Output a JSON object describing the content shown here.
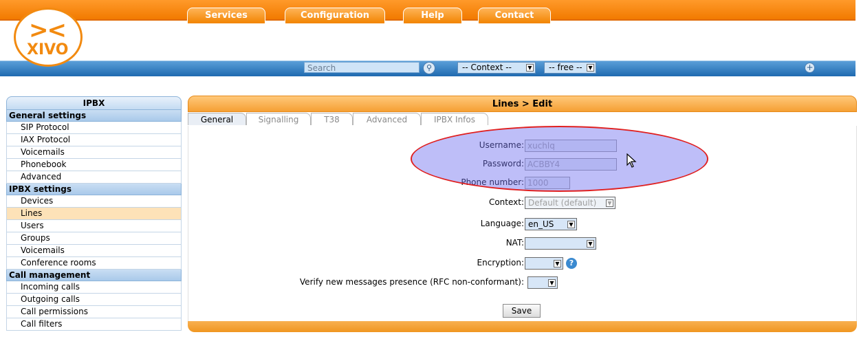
{
  "header": {
    "nav_tabs": [
      "Services",
      "Configuration",
      "Help",
      "Contact"
    ],
    "logo_text": "XIVO",
    "search": {
      "placeholder": "Search"
    },
    "context_select": "-- Context --",
    "free_select": "-- free --"
  },
  "sidebar": {
    "title": "IPBX",
    "sections": [
      {
        "title": "General settings",
        "items": [
          "SIP Protocol",
          "IAX Protocol",
          "Voicemails",
          "Phonebook",
          "Advanced"
        ]
      },
      {
        "title": "IPBX settings",
        "items": [
          "Devices",
          "Lines",
          "Users",
          "Groups",
          "Voicemails",
          "Conference rooms"
        ]
      },
      {
        "title": "Call management",
        "items": [
          "Incoming calls",
          "Outgoing calls",
          "Call permissions",
          "Call filters"
        ]
      }
    ],
    "active_item": "Lines"
  },
  "main": {
    "title": "Lines > Edit",
    "tabs": [
      "General",
      "Signalling",
      "T38",
      "Advanced",
      "IPBX Infos"
    ],
    "active_tab": "General",
    "fields": {
      "username": {
        "label": "Username:",
        "value": "xuchlq"
      },
      "password": {
        "label": "Password:",
        "value": "ACBBY4"
      },
      "phone_number": {
        "label": "Phone number:",
        "value": "1000"
      },
      "context": {
        "label": "Context:",
        "value": "Default (default)"
      },
      "language": {
        "label": "Language:",
        "value": "en_US"
      },
      "nat": {
        "label": "NAT:",
        "value": ""
      },
      "encryption": {
        "label": "Encryption:",
        "value": ""
      },
      "verify": {
        "label": "Verify new messages presence (RFC non-conformant):",
        "value": ""
      }
    },
    "save_label": "Save"
  },
  "icons": {
    "search": "magnifier-icon",
    "plus": "plus-circle-icon",
    "help": "help-icon",
    "cursor": "mouse-cursor-icon"
  },
  "colors": {
    "orange": "#f28a10",
    "blue": "#1f6ab0",
    "highlight": "#6e6ef0",
    "highlight_border": "#e02020"
  }
}
